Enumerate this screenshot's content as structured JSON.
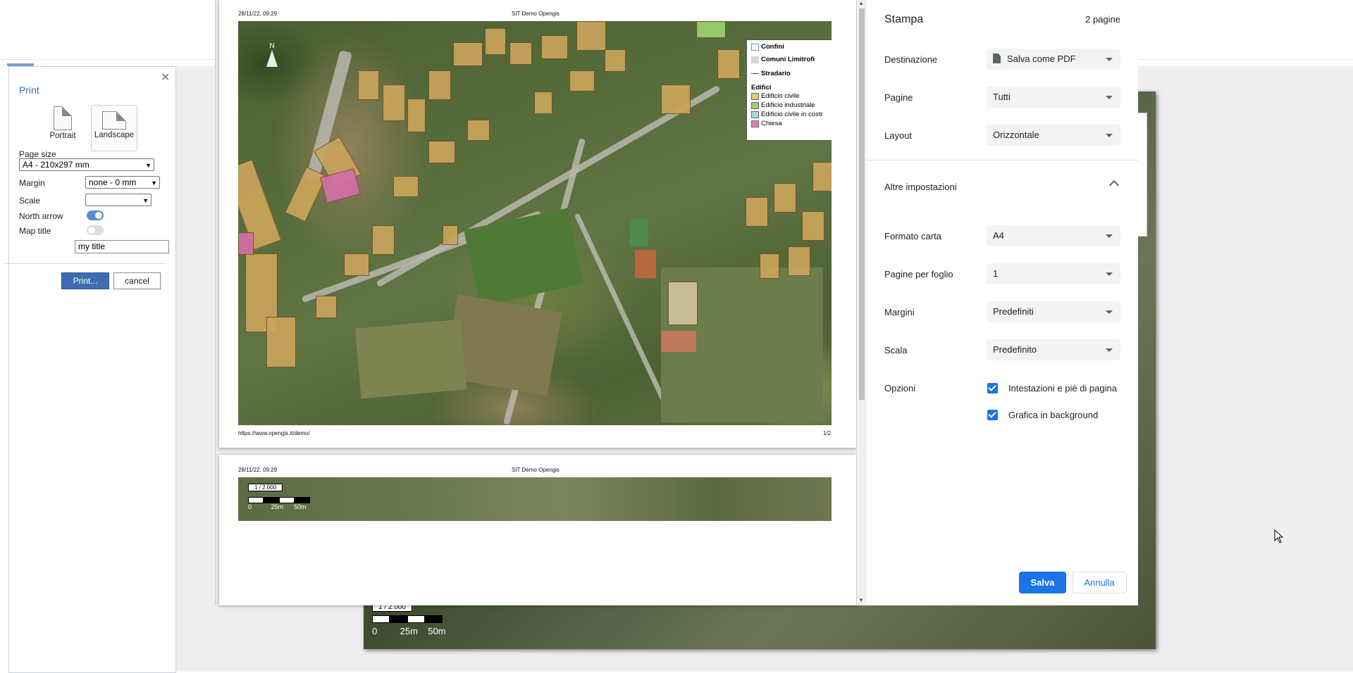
{
  "print_panel": {
    "title": "Print",
    "orientation": {
      "portrait": "Portrait",
      "landscape": "Landscape"
    },
    "page_size_label": "Page size",
    "page_size_value": "A4 - 210x297 mm",
    "margin_label": "Margin",
    "margin_value": "none - 0 mm",
    "scale_label": "Scale",
    "scale_value": "",
    "north_arrow_label": "North arrow",
    "north_arrow_on": true,
    "map_title_label": "Map title",
    "map_title_on": false,
    "map_title_value": "my title",
    "print_button": "Print...",
    "cancel_button": "cancel"
  },
  "preview": {
    "page1": {
      "datetime": "28/11/22, 09:29",
      "site": "SIT Demo Opengis",
      "url": "https://www.opengis.it/demo/",
      "page_number": "1/2"
    },
    "page2": {
      "datetime": "28/11/22, 09:29",
      "site": "SIT Demo Opengis"
    },
    "north_label": "N",
    "legend": {
      "confini": "Confini",
      "comuni": "Comuni Limitrofi",
      "stradario": "Stradario",
      "edifici": "Edifici",
      "items": [
        {
          "label": "Edificio civile",
          "color": "#e8c57a"
        },
        {
          "label": "Edificio industriale",
          "color": "#9ad06d"
        },
        {
          "label": "Edificio civile in costr",
          "color": "#a9d6e6"
        },
        {
          "label": "Chiesa",
          "color": "#e77ab6"
        }
      ]
    },
    "scale": {
      "ratio": "1 / 2.000",
      "labels": [
        "0",
        "25m",
        "50m"
      ]
    }
  },
  "background_map": {
    "scale_ratio": "1 / 2.000",
    "scale_labels": [
      "0",
      "25m",
      "50m"
    ]
  },
  "chrome_print": {
    "title": "Stampa",
    "pages_count": "2 pagine",
    "destination_label": "Destinazione",
    "destination_value": "Salva come PDF",
    "pages_label": "Pagine",
    "pages_value": "Tutti",
    "layout_label": "Layout",
    "layout_value": "Orizzontale",
    "more_settings": "Altre impostazioni",
    "paper_label": "Formato carta",
    "paper_value": "A4",
    "pps_label": "Pagine per foglio",
    "pps_value": "1",
    "margins_label": "Margini",
    "margins_value": "Predefiniti",
    "scale_label": "Scala",
    "scale_value": "Predefinito",
    "options_label": "Opzioni",
    "option_headers": "Intestazioni e piè di pagina",
    "option_headers_checked": true,
    "option_background": "Grafica in background",
    "option_background_checked": true,
    "save_button": "Salva",
    "cancel_button": "Annulla",
    "accent_color": "#1a73e8"
  }
}
